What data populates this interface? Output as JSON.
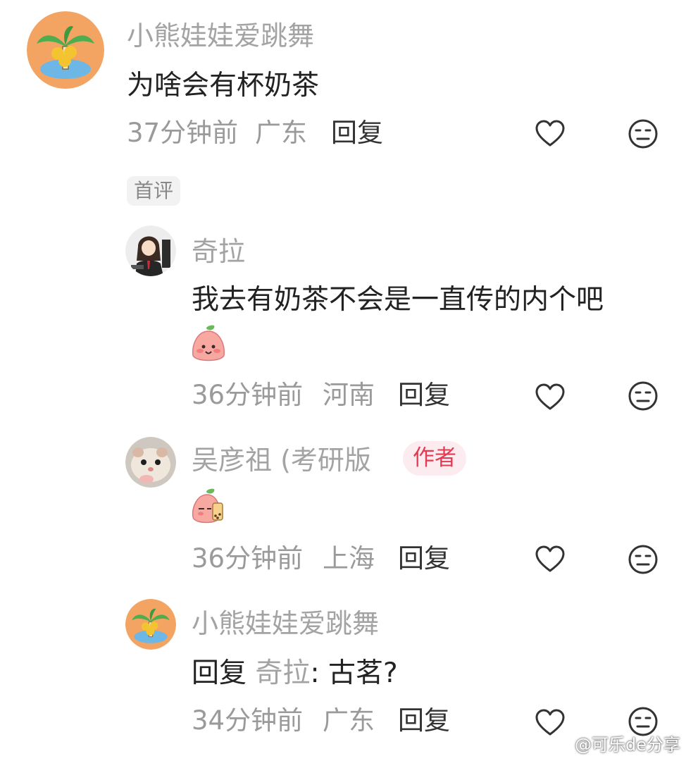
{
  "comments": [
    {
      "name": "小熊娃娃爱跳舞",
      "text": "为啥会有杯奶茶",
      "time": "37分钟前",
      "location": "广东",
      "reply": "回复",
      "badge": "首评"
    },
    {
      "name": "奇拉",
      "text": "我去有奶茶不会是一直传的内个吧",
      "time": "36分钟前",
      "location": "河南",
      "reply": "回复"
    },
    {
      "name": "吴彦祖 (考研版",
      "author_badge": "作者",
      "time": "36分钟前",
      "location": "上海",
      "reply": "回复"
    },
    {
      "name": "小熊娃娃爱跳舞",
      "reply_prefix": "回复",
      "reply_to": "奇拉",
      "reply_text": ": 古茗?",
      "time": "34分钟前",
      "location": "广东",
      "reply": "回复"
    }
  ],
  "watermark": "@可乐de分享",
  "icons": [
    "heart-icon",
    "dislike-face-icon",
    "weibo-logo-icon"
  ],
  "colors": {
    "author_badge_text": "#e23b53",
    "author_badge_bg": "#fdecef",
    "name": "#a3a3a3",
    "meta": "#9a9a9a",
    "body": "#222222"
  }
}
